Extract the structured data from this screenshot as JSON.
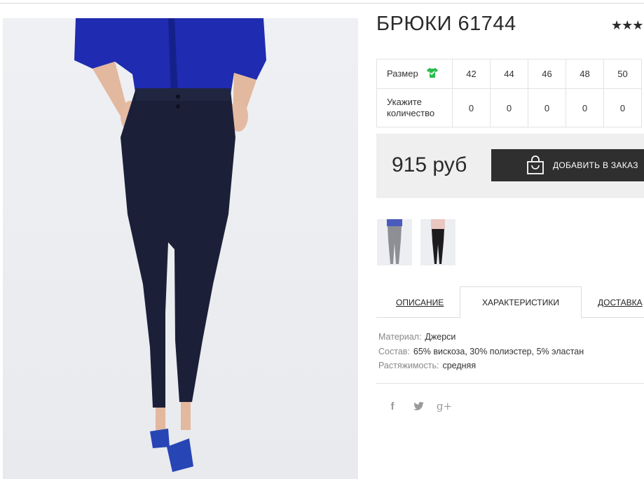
{
  "product": {
    "title": "БРЮКИ 61744",
    "stars": "★★★"
  },
  "sizes": {
    "size_label": "Размер",
    "qty_label_line1": "Укажите",
    "qty_label_line2": "количество",
    "values": [
      "42",
      "44",
      "46",
      "48",
      "50"
    ],
    "quantities": [
      "0",
      "0",
      "0",
      "0",
      "0"
    ]
  },
  "order": {
    "price": "915 руб",
    "add_button": "ДОБАВИТЬ В ЗАКАЗ"
  },
  "tabs": {
    "description": "ОПИСАНИЕ",
    "characteristics": "ХАРАКТЕРИСТИКИ",
    "delivery": "ДОСТАВКА"
  },
  "specs": [
    {
      "key": "Материал:",
      "value": "Джерси"
    },
    {
      "key": "Состав:",
      "value": "65% вискоза, 30% полиэстер, 5% эластан"
    },
    {
      "key": "Растяжимость:",
      "value": "средняя"
    }
  ],
  "social": {
    "facebook": "f",
    "twitter": "twitter-icon",
    "googleplus": "g+"
  },
  "colors": {
    "dark_button": "#2f2f2f",
    "shirt_blue": "#1f2bb0",
    "pants_navy": "#1b2038",
    "size_icon_green": "#2dbb4f"
  }
}
